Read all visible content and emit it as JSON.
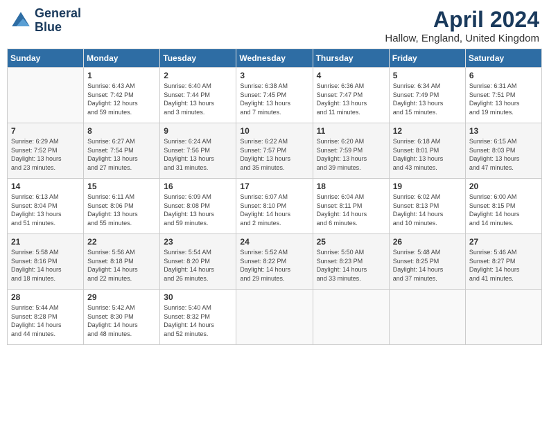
{
  "header": {
    "logo_line1": "General",
    "logo_line2": "Blue",
    "month": "April 2024",
    "location": "Hallow, England, United Kingdom"
  },
  "weekdays": [
    "Sunday",
    "Monday",
    "Tuesday",
    "Wednesday",
    "Thursday",
    "Friday",
    "Saturday"
  ],
  "weeks": [
    [
      {
        "day": "",
        "info": ""
      },
      {
        "day": "1",
        "info": "Sunrise: 6:43 AM\nSunset: 7:42 PM\nDaylight: 12 hours\nand 59 minutes."
      },
      {
        "day": "2",
        "info": "Sunrise: 6:40 AM\nSunset: 7:44 PM\nDaylight: 13 hours\nand 3 minutes."
      },
      {
        "day": "3",
        "info": "Sunrise: 6:38 AM\nSunset: 7:45 PM\nDaylight: 13 hours\nand 7 minutes."
      },
      {
        "day": "4",
        "info": "Sunrise: 6:36 AM\nSunset: 7:47 PM\nDaylight: 13 hours\nand 11 minutes."
      },
      {
        "day": "5",
        "info": "Sunrise: 6:34 AM\nSunset: 7:49 PM\nDaylight: 13 hours\nand 15 minutes."
      },
      {
        "day": "6",
        "info": "Sunrise: 6:31 AM\nSunset: 7:51 PM\nDaylight: 13 hours\nand 19 minutes."
      }
    ],
    [
      {
        "day": "7",
        "info": "Sunrise: 6:29 AM\nSunset: 7:52 PM\nDaylight: 13 hours\nand 23 minutes."
      },
      {
        "day": "8",
        "info": "Sunrise: 6:27 AM\nSunset: 7:54 PM\nDaylight: 13 hours\nand 27 minutes."
      },
      {
        "day": "9",
        "info": "Sunrise: 6:24 AM\nSunset: 7:56 PM\nDaylight: 13 hours\nand 31 minutes."
      },
      {
        "day": "10",
        "info": "Sunrise: 6:22 AM\nSunset: 7:57 PM\nDaylight: 13 hours\nand 35 minutes."
      },
      {
        "day": "11",
        "info": "Sunrise: 6:20 AM\nSunset: 7:59 PM\nDaylight: 13 hours\nand 39 minutes."
      },
      {
        "day": "12",
        "info": "Sunrise: 6:18 AM\nSunset: 8:01 PM\nDaylight: 13 hours\nand 43 minutes."
      },
      {
        "day": "13",
        "info": "Sunrise: 6:15 AM\nSunset: 8:03 PM\nDaylight: 13 hours\nand 47 minutes."
      }
    ],
    [
      {
        "day": "14",
        "info": "Sunrise: 6:13 AM\nSunset: 8:04 PM\nDaylight: 13 hours\nand 51 minutes."
      },
      {
        "day": "15",
        "info": "Sunrise: 6:11 AM\nSunset: 8:06 PM\nDaylight: 13 hours\nand 55 minutes."
      },
      {
        "day": "16",
        "info": "Sunrise: 6:09 AM\nSunset: 8:08 PM\nDaylight: 13 hours\nand 59 minutes."
      },
      {
        "day": "17",
        "info": "Sunrise: 6:07 AM\nSunset: 8:10 PM\nDaylight: 14 hours\nand 2 minutes."
      },
      {
        "day": "18",
        "info": "Sunrise: 6:04 AM\nSunset: 8:11 PM\nDaylight: 14 hours\nand 6 minutes."
      },
      {
        "day": "19",
        "info": "Sunrise: 6:02 AM\nSunset: 8:13 PM\nDaylight: 14 hours\nand 10 minutes."
      },
      {
        "day": "20",
        "info": "Sunrise: 6:00 AM\nSunset: 8:15 PM\nDaylight: 14 hours\nand 14 minutes."
      }
    ],
    [
      {
        "day": "21",
        "info": "Sunrise: 5:58 AM\nSunset: 8:16 PM\nDaylight: 14 hours\nand 18 minutes."
      },
      {
        "day": "22",
        "info": "Sunrise: 5:56 AM\nSunset: 8:18 PM\nDaylight: 14 hours\nand 22 minutes."
      },
      {
        "day": "23",
        "info": "Sunrise: 5:54 AM\nSunset: 8:20 PM\nDaylight: 14 hours\nand 26 minutes."
      },
      {
        "day": "24",
        "info": "Sunrise: 5:52 AM\nSunset: 8:22 PM\nDaylight: 14 hours\nand 29 minutes."
      },
      {
        "day": "25",
        "info": "Sunrise: 5:50 AM\nSunset: 8:23 PM\nDaylight: 14 hours\nand 33 minutes."
      },
      {
        "day": "26",
        "info": "Sunrise: 5:48 AM\nSunset: 8:25 PM\nDaylight: 14 hours\nand 37 minutes."
      },
      {
        "day": "27",
        "info": "Sunrise: 5:46 AM\nSunset: 8:27 PM\nDaylight: 14 hours\nand 41 minutes."
      }
    ],
    [
      {
        "day": "28",
        "info": "Sunrise: 5:44 AM\nSunset: 8:28 PM\nDaylight: 14 hours\nand 44 minutes."
      },
      {
        "day": "29",
        "info": "Sunrise: 5:42 AM\nSunset: 8:30 PM\nDaylight: 14 hours\nand 48 minutes."
      },
      {
        "day": "30",
        "info": "Sunrise: 5:40 AM\nSunset: 8:32 PM\nDaylight: 14 hours\nand 52 minutes."
      },
      {
        "day": "",
        "info": ""
      },
      {
        "day": "",
        "info": ""
      },
      {
        "day": "",
        "info": ""
      },
      {
        "day": "",
        "info": ""
      }
    ]
  ]
}
